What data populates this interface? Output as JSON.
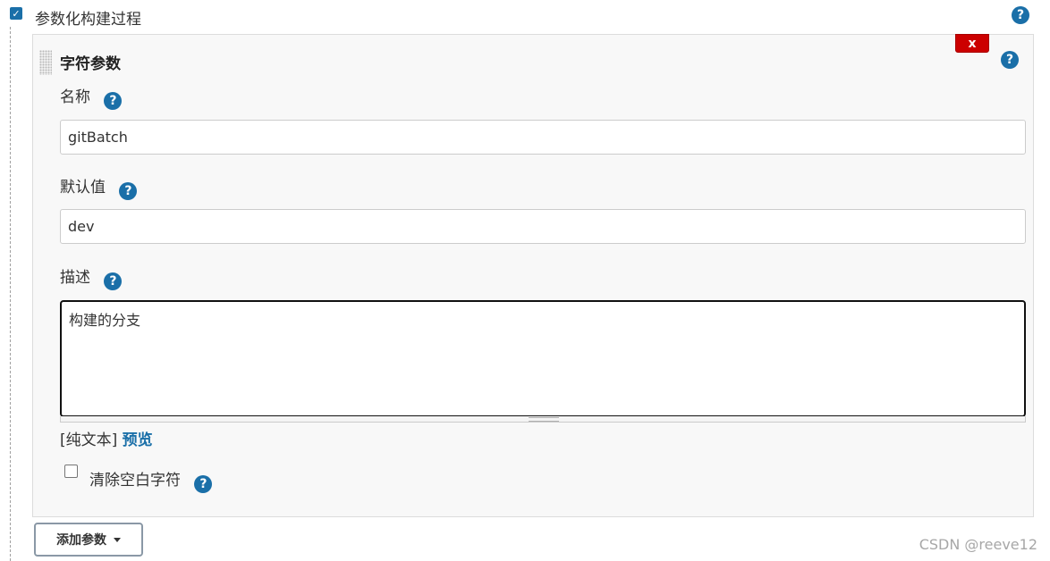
{
  "parameterized": {
    "checked": true,
    "label": "参数化构建过程",
    "help_glyph": "?"
  },
  "string_param": {
    "title": "字符参数",
    "delete_label": "x",
    "help_glyph": "?",
    "name": {
      "label": "名称",
      "help_glyph": "?",
      "value": "gitBatch"
    },
    "default": {
      "label": "默认值",
      "help_glyph": "?",
      "value": "dev"
    },
    "description": {
      "label": "描述",
      "help_glyph": "?",
      "value": "构建的分支",
      "markup_text": "[纯文本]",
      "preview_label": "预览"
    },
    "trim": {
      "label": "清除空白字符",
      "checked": false,
      "help_glyph": "?"
    }
  },
  "add_param": {
    "label": "添加参数",
    "icon": "caret-down-icon"
  },
  "watermark": "CSDN @reeve12",
  "colors": {
    "accent": "#1a6fa8",
    "delete": "#cc0000"
  }
}
